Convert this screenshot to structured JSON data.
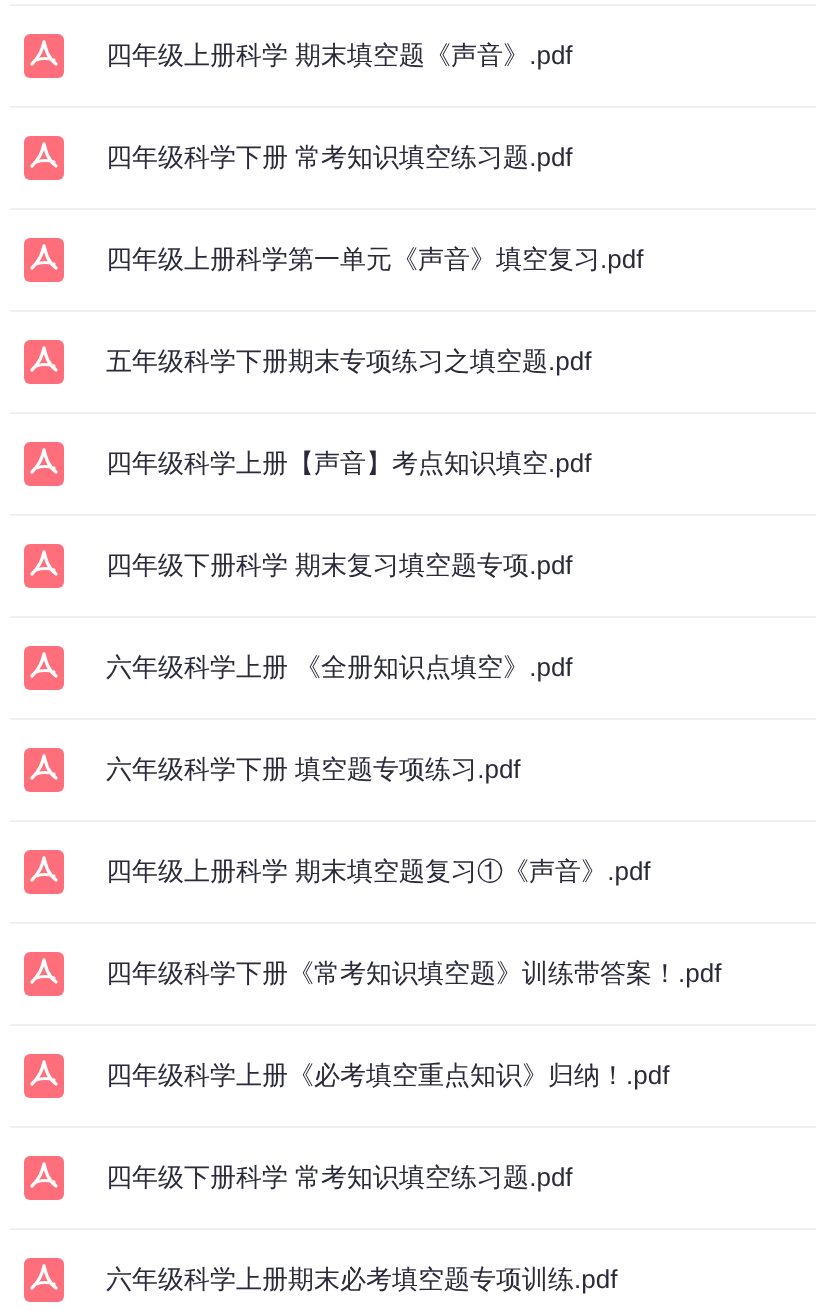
{
  "files": [
    {
      "name": "四年级上册科学 期末填空题《声音》.pdf"
    },
    {
      "name": "四年级科学下册 常考知识填空练习题.pdf"
    },
    {
      "name": "四年级上册科学第一单元《声音》填空复习.pdf"
    },
    {
      "name": "五年级科学下册期末专项练习之填空题.pdf"
    },
    {
      "name": "四年级科学上册【声音】考点知识填空.pdf"
    },
    {
      "name": "四年级下册科学 期末复习填空题专项.pdf"
    },
    {
      "name": "六年级科学上册 《全册知识点填空》.pdf"
    },
    {
      "name": "六年级科学下册 填空题专项练习.pdf"
    },
    {
      "name": "四年级上册科学 期末填空题复习①《声音》.pdf"
    },
    {
      "name": "四年级科学下册《常考知识填空题》训练带答案！.pdf"
    },
    {
      "name": "四年级科学上册《必考填空重点知识》归纳！.pdf"
    },
    {
      "name": "四年级下册科学 常考知识填空练习题.pdf"
    },
    {
      "name": "六年级科学上册期末必考填空题专项训练.pdf"
    }
  ]
}
